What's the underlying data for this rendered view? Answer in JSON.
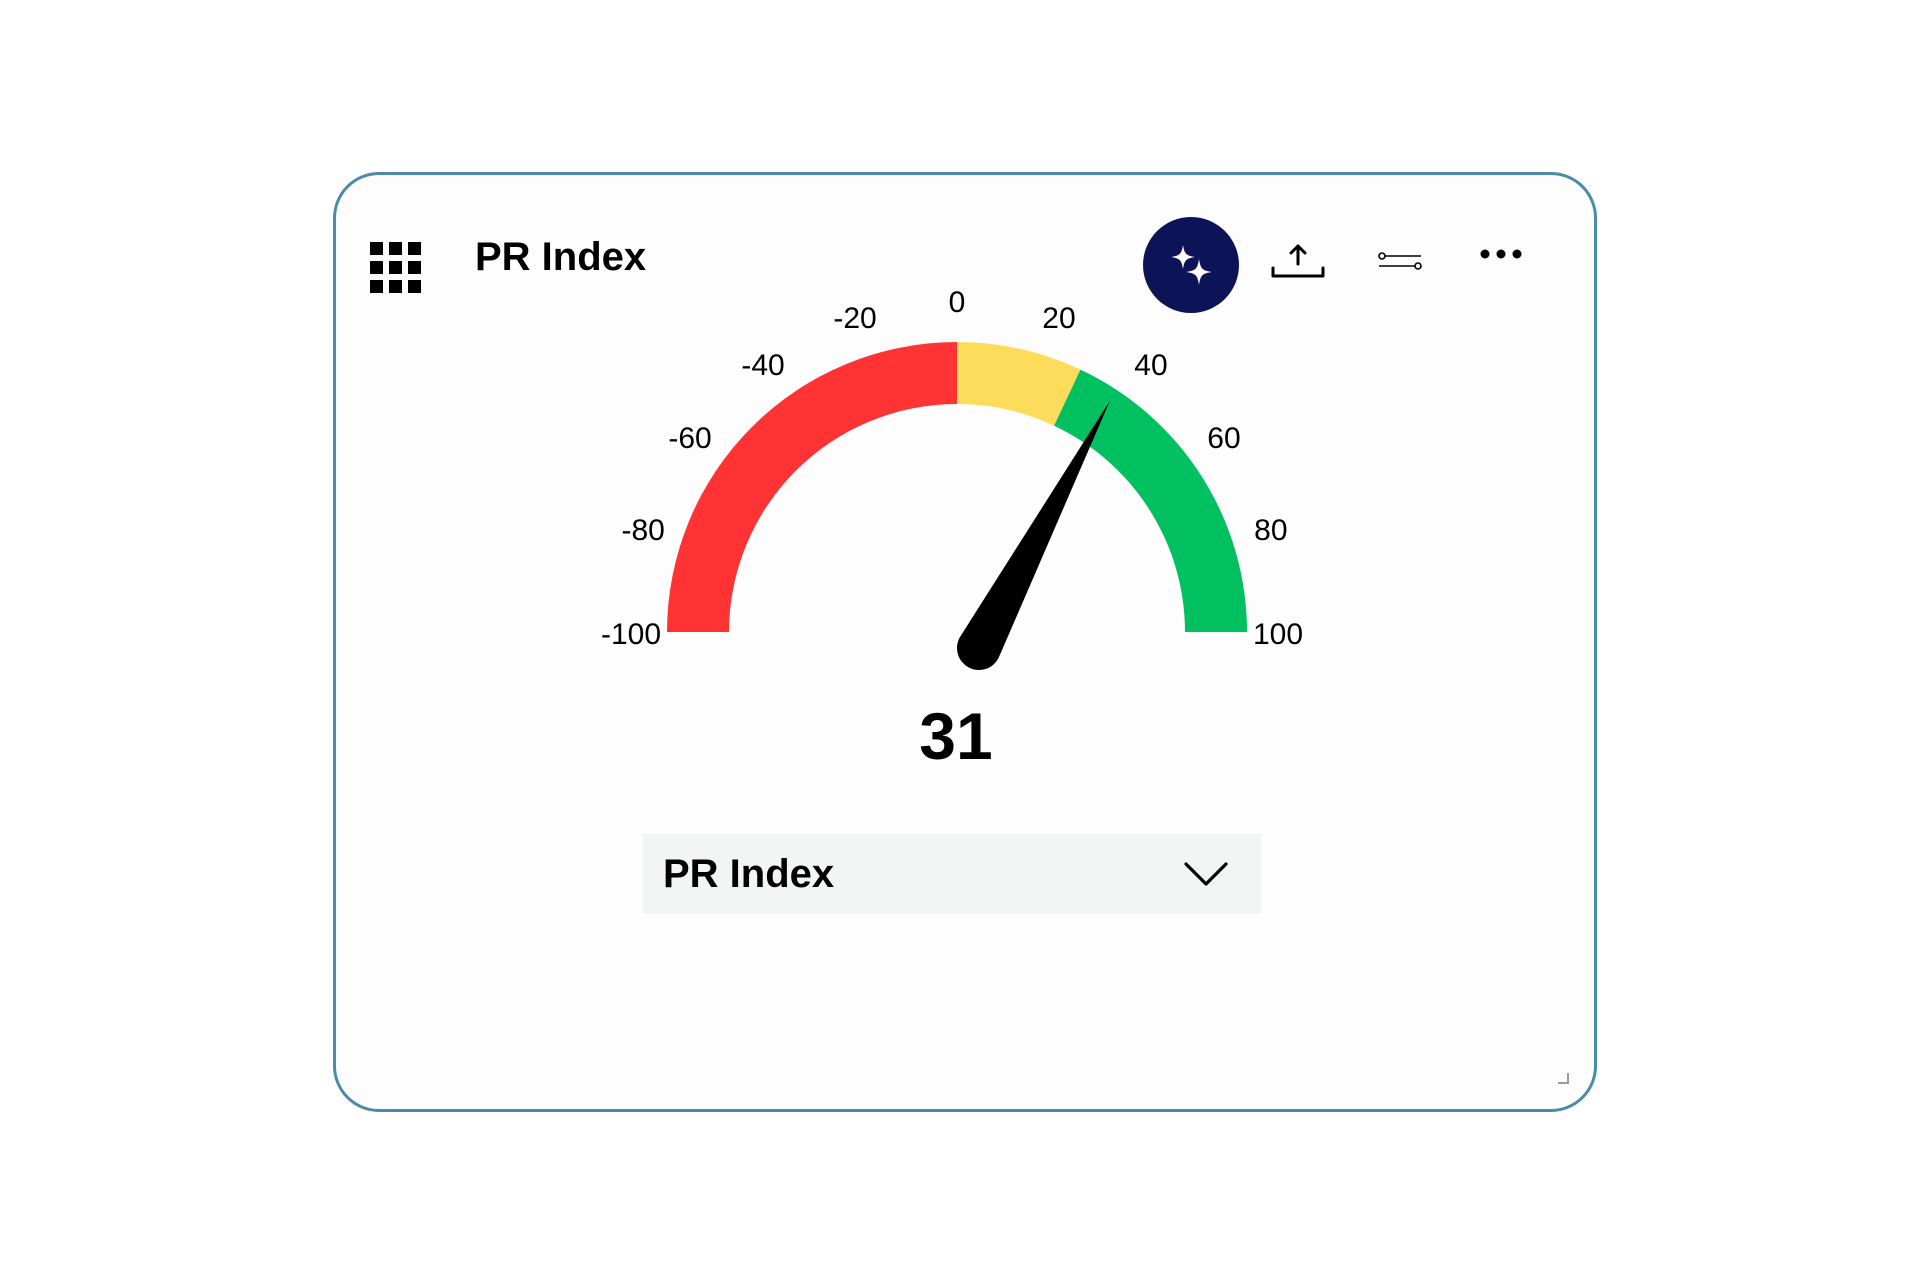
{
  "card": {
    "title": "PR Index",
    "toolbar": {
      "ai_icon": "sparkles-icon",
      "export_icon": "upload-icon",
      "filter_icon": "filter-sliders-icon",
      "more_icon": "more-horizontal-icon"
    }
  },
  "gauge": {
    "value": 31,
    "display_value": "31",
    "min": -100,
    "max": 100,
    "ticks": [
      "-100",
      "-80",
      "-60",
      "-40",
      "-20",
      "0",
      "20",
      "40",
      "60",
      "80",
      "100"
    ],
    "bands": [
      {
        "from": -100,
        "to": 0,
        "color": "#ff3333"
      },
      {
        "from": 0,
        "to": 28,
        "color": "#fddc5c"
      },
      {
        "from": 28,
        "to": 100,
        "color": "#00c060"
      }
    ],
    "needle_color": "#000000"
  },
  "metric_select": {
    "selected": "PR Index",
    "icon": "chevron-down-icon"
  },
  "colors": {
    "card_border": "#4a8ba8",
    "ai_button_bg": "#0c1457",
    "select_bg": "#f3f4f4"
  }
}
